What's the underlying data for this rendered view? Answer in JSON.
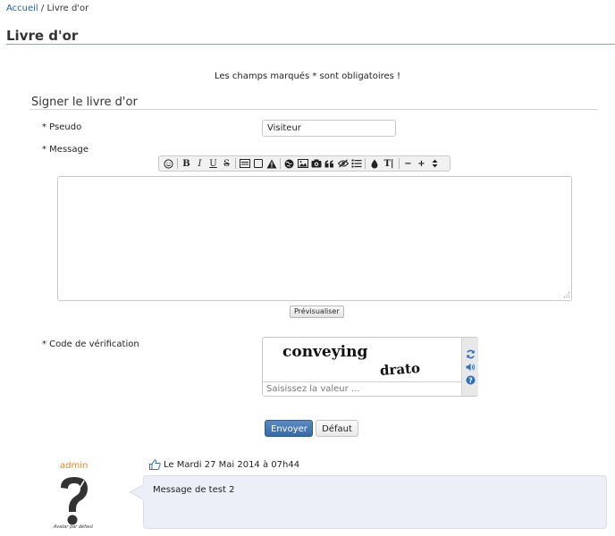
{
  "breadcrumb": {
    "home": "Accueil",
    "separator": "/",
    "current": "Livre d'or"
  },
  "page": {
    "title": "Livre d'or",
    "required_note": "Les champs marqués * sont obligatoires !"
  },
  "form": {
    "section_title": "Signer le livre d'or",
    "pseudo_label": "* Pseudo",
    "pseudo_value": "Visiteur",
    "message_label": "* Message",
    "message_value": "",
    "preview_button": "Prévisualiser",
    "captcha_label": "* Code de vérification",
    "captcha_words": [
      "conveying",
      "drato"
    ],
    "captcha_placeholder": "Saisissez la valeur ...",
    "submit_button": "Envoyer",
    "reset_button": "Défaut"
  },
  "toolbar": {
    "icons": [
      "smiley-icon",
      "bold-icon",
      "italic-icon",
      "underline-icon",
      "strikethrough-icon",
      "block-icon",
      "frame-icon",
      "warning-icon",
      "link-icon",
      "image-icon",
      "camera-icon",
      "quote-icon",
      "hide-icon",
      "list-icon",
      "color-icon",
      "font-size-icon",
      "decrease-icon",
      "increase-icon",
      "size-select-icon"
    ],
    "bold": "B",
    "italic": "I",
    "underline": "U",
    "strike": "S",
    "fontsize": "T|",
    "minus": "−",
    "plus": "+"
  },
  "post": {
    "author": "admin",
    "date": "Le Mardi 27 Mai 2014 à 07h44",
    "message": "Message de test 2",
    "avatar_caption": "Avatar par défaut"
  },
  "colors": {
    "link": "#1f5fa8",
    "author": "#e8871a",
    "primary_button": "#376aa6",
    "bubble": "#eceef8"
  }
}
